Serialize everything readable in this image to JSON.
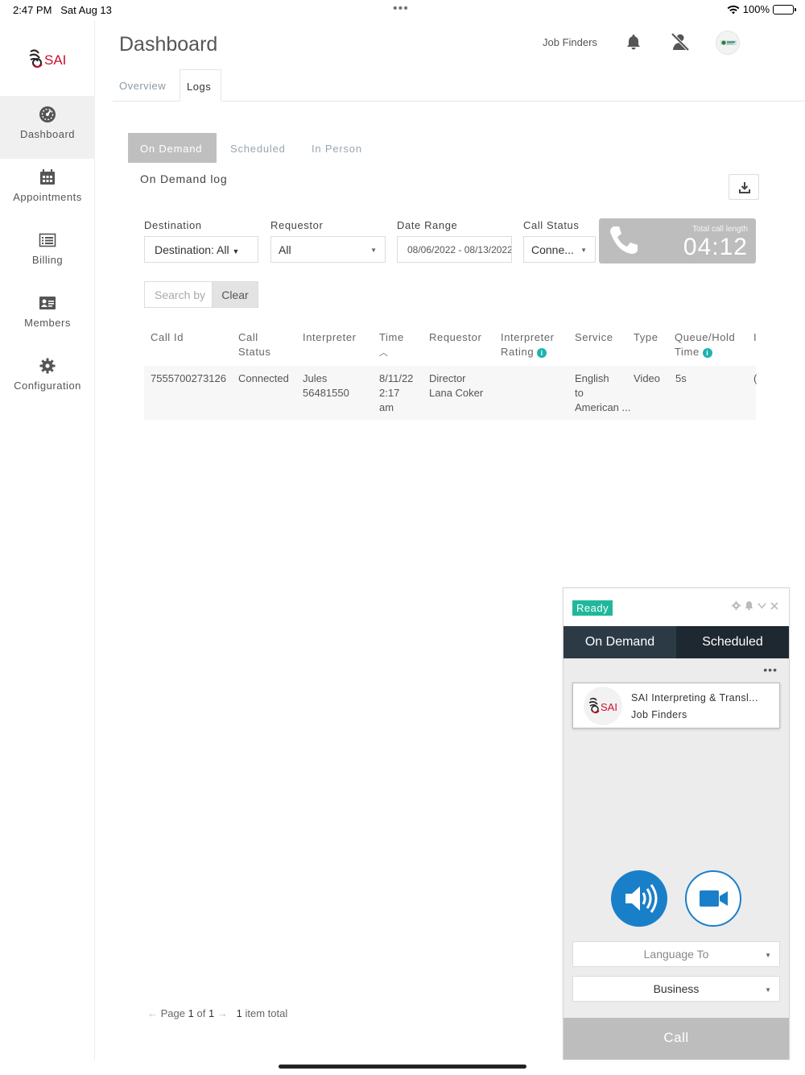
{
  "status_bar": {
    "time": "2:47 PM",
    "date": "Sat Aug 13",
    "battery": "100%"
  },
  "sidebar": {
    "logo_text": "SAI",
    "items": [
      {
        "label": "Dashboard",
        "icon": "dashboard-icon"
      },
      {
        "label": "Appointments",
        "icon": "calendar-icon"
      },
      {
        "label": "Billing",
        "icon": "billing-icon"
      },
      {
        "label": "Members",
        "icon": "id-card-icon"
      },
      {
        "label": "Configuration",
        "icon": "gear-icon"
      }
    ]
  },
  "header": {
    "title": "Dashboard",
    "company": "Job Finders"
  },
  "tabs": [
    "Overview",
    "Logs"
  ],
  "subtabs": [
    "On Demand",
    "Scheduled",
    "In Person"
  ],
  "log": {
    "title": "On Demand log",
    "filters": {
      "destination_label": "Destination",
      "destination_value": "Destination: All",
      "requestor_label": "Requestor",
      "requestor_value": "All",
      "date_label": "Date Range",
      "date_value": "08/06/2022 - 08/13/2022",
      "status_label": "Call Status",
      "status_value": "Conne..."
    },
    "total_call": {
      "label": "Total call length",
      "value": "04:12"
    },
    "search_placeholder": "Search by",
    "clear_label": "Clear",
    "columns": [
      "Call Id",
      "Call Status",
      "Interpreter",
      "Time",
      "Requestor",
      "Interpreter Rating",
      "Service",
      "Type",
      "Queue/Hold Time",
      "I"
    ],
    "rows": [
      {
        "call_id": "7555700273126",
        "status": "Connected",
        "interpreter_1": "Jules",
        "interpreter_2": "56481550",
        "time_1": "8/11/22",
        "time_2": "2:17",
        "time_3": "am",
        "requestor_1": "Director",
        "requestor_2": "Lana Coker",
        "service_1": "English",
        "service_2": "to",
        "service_3": "American ...",
        "type": "Video",
        "queue": "5s",
        "extra": "("
      }
    ],
    "pager": {
      "page_word": "Page",
      "page": "1",
      "of_word": "of",
      "total_pages": "1",
      "count": "1",
      "count_label": "item total"
    }
  },
  "widget": {
    "status": "Ready",
    "tabs": [
      "On Demand",
      "Scheduled"
    ],
    "contact_line1": "SAI Interpreting & Transl...",
    "contact_line2": "Job Finders",
    "language_to": "Language To",
    "category": "Business",
    "call_label": "Call"
  },
  "colors": {
    "accent_blue": "#1a7fc9",
    "ready_green": "#1fb89a",
    "info_teal": "#1fb2b2",
    "widget_dark": "#2c3a45",
    "subtab_active": "#bfbfbf"
  }
}
